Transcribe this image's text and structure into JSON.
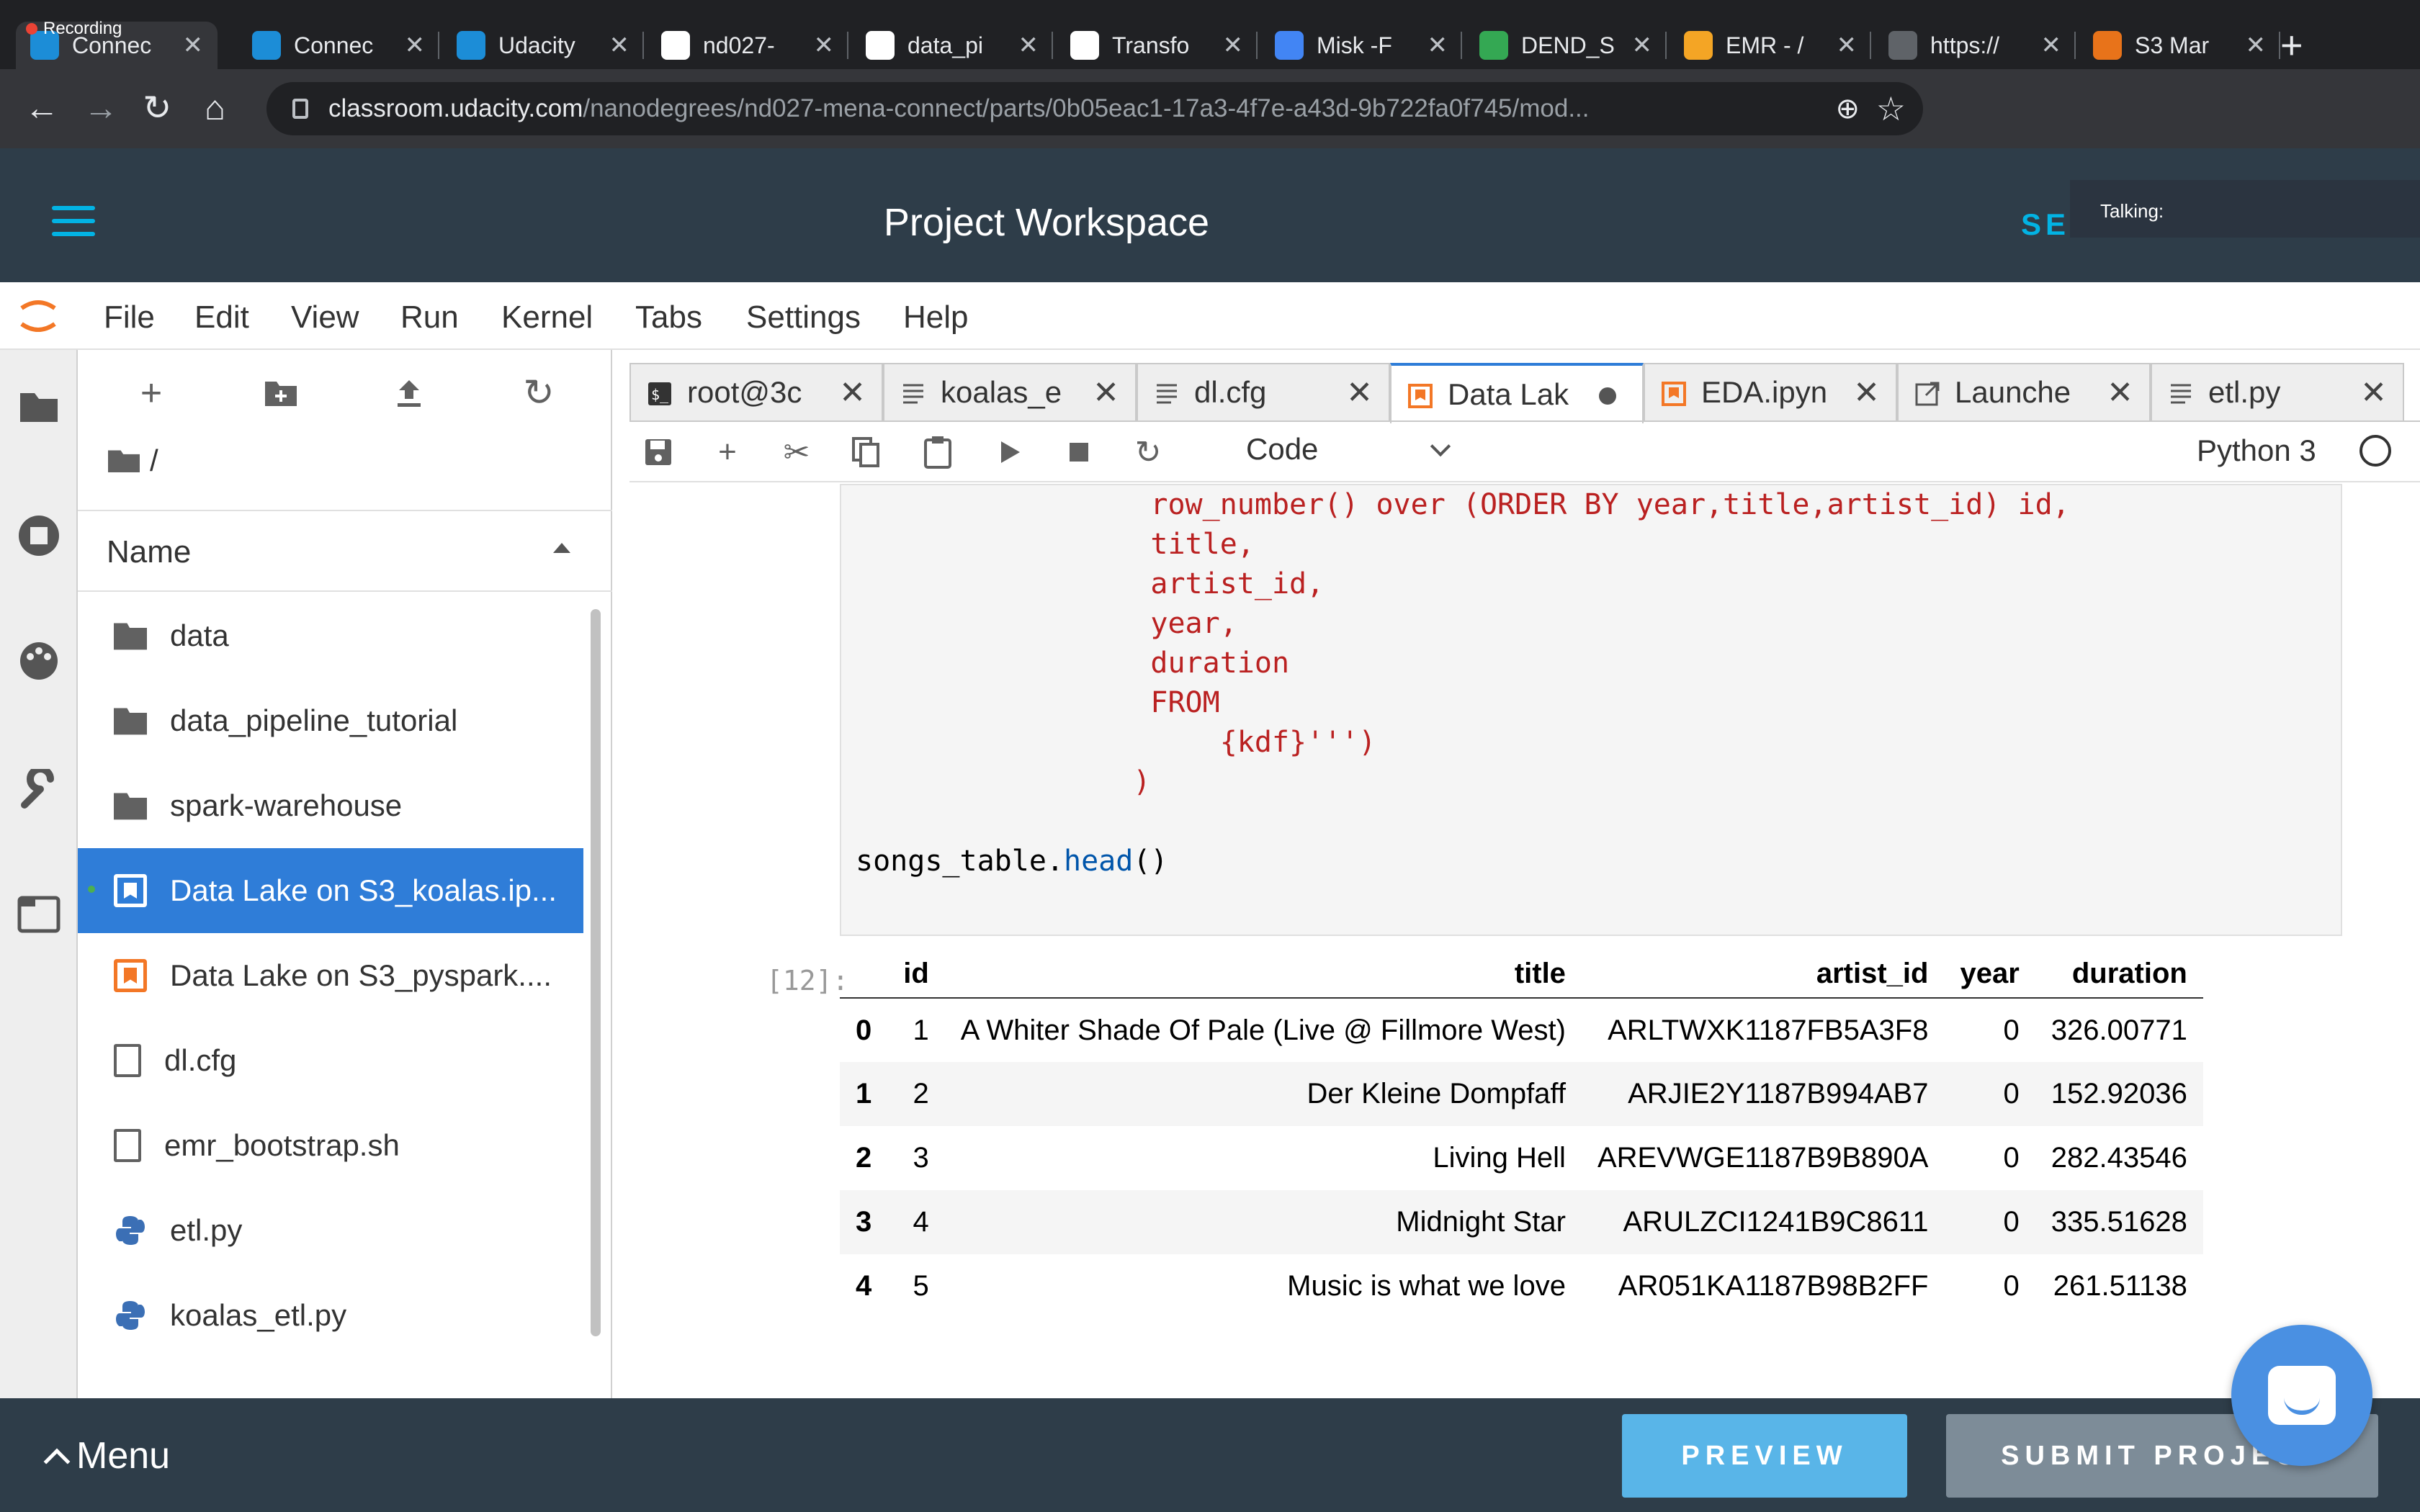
{
  "recording": {
    "label": "Recording"
  },
  "browser": {
    "tabs": [
      {
        "title": "Connec",
        "favicon": "udacity-icon",
        "color": "#1c8dd7",
        "active": true
      },
      {
        "title": "Connec",
        "favicon": "udacity-icon",
        "color": "#1c8dd7"
      },
      {
        "title": "Udacity",
        "favicon": "udacity-icon",
        "color": "#1c8dd7"
      },
      {
        "title": "nd027-",
        "favicon": "github-icon",
        "color": "#ffffff"
      },
      {
        "title": "data_pi",
        "favicon": "github-icon",
        "color": "#ffffff"
      },
      {
        "title": "Transfo",
        "favicon": "hug-icon",
        "color": "#ffffff"
      },
      {
        "title": "Misk -F",
        "favicon": "docs-icon",
        "color": "#4285f4"
      },
      {
        "title": "DEND_S",
        "favicon": "sheets-icon",
        "color": "#34a853"
      },
      {
        "title": "EMR - /",
        "favicon": "aws-box-icon",
        "color": "#f4a525"
      },
      {
        "title": "https://",
        "favicon": "globe-icon",
        "color": "#5f6368"
      },
      {
        "title": "S3 Mar",
        "favicon": "aws-s3-icon",
        "color": "#e8731a"
      }
    ],
    "url_host": "classroom.udacity.com",
    "url_path": "/nanodegrees/nd027-mena-connect/parts/0b05eac1-17a3-4f7e-a43d-9b722fa0f745/mod..."
  },
  "header": {
    "title": "Project Workspace",
    "right_text": "SEI",
    "talking": "Talking:",
    "accent": "#02b3e4"
  },
  "menubar": [
    "File",
    "Edit",
    "View",
    "Run",
    "Kernel",
    "Tabs",
    "Settings",
    "Help"
  ],
  "filebrowser": {
    "path": "/",
    "column": "Name",
    "items": [
      {
        "name": "data",
        "type": "folder"
      },
      {
        "name": "data_pipeline_tutorial",
        "type": "folder"
      },
      {
        "name": "spark-warehouse",
        "type": "folder"
      },
      {
        "name": "Data Lake on S3_koalas.ip...",
        "type": "notebook",
        "selected": true
      },
      {
        "name": "Data Lake on S3_pyspark....",
        "type": "notebook"
      },
      {
        "name": "dl.cfg",
        "type": "file"
      },
      {
        "name": "emr_bootstrap.sh",
        "type": "file"
      },
      {
        "name": "etl.py",
        "type": "python"
      },
      {
        "name": "koalas_etl.py",
        "type": "python"
      }
    ]
  },
  "doc_tabs": [
    {
      "title": "root@3c",
      "icon": "terminal-icon"
    },
    {
      "title": "koalas_e",
      "icon": "text-file-icon"
    },
    {
      "title": "dl.cfg",
      "icon": "text-file-icon"
    },
    {
      "title": "Data Lak",
      "icon": "notebook-icon",
      "active": true,
      "dirty": true
    },
    {
      "title": "EDA.ipyn",
      "icon": "notebook-icon"
    },
    {
      "title": "Launche",
      "icon": "launcher-icon"
    },
    {
      "title": "etl.py",
      "icon": "text-file-icon"
    }
  ],
  "notebook": {
    "cell_type": "Code",
    "kernel": "Python 3",
    "code_lines": [
      "                 row_number() over (ORDER BY year,title,artist_id) id,",
      "                 title,",
      "                 artist_id,",
      "                 year,",
      "                 duration",
      "                 FROM",
      "                     {kdf}''')",
      "                )",
      ""
    ],
    "last_line": {
      "object": "songs_table.",
      "method": "head",
      "suffix": "()"
    },
    "output_prompt": "[12]:",
    "table": {
      "columns": [
        "",
        "id",
        "title",
        "artist_id",
        "year",
        "duration"
      ],
      "rows": [
        [
          "0",
          "1",
          "A Whiter Shade Of Pale (Live @ Fillmore West)",
          "ARLTWXK1187FB5A3F8",
          "0",
          "326.00771"
        ],
        [
          "1",
          "2",
          "Der Kleine Dompfaff",
          "ARJIE2Y1187B994AB7",
          "0",
          "152.92036"
        ],
        [
          "2",
          "3",
          "Living Hell",
          "AREVWGE1187B9B890A",
          "0",
          "282.43546"
        ],
        [
          "3",
          "4",
          "Midnight Star",
          "ARULZCI1241B9C8611",
          "0",
          "335.51628"
        ],
        [
          "4",
          "5",
          "Music is what we love",
          "AR051KA1187B98B2FF",
          "0",
          "261.51138"
        ]
      ]
    }
  },
  "footer": {
    "menu": "Menu",
    "preview": "PREVIEW",
    "submit": "SUBMIT PROJECT"
  }
}
